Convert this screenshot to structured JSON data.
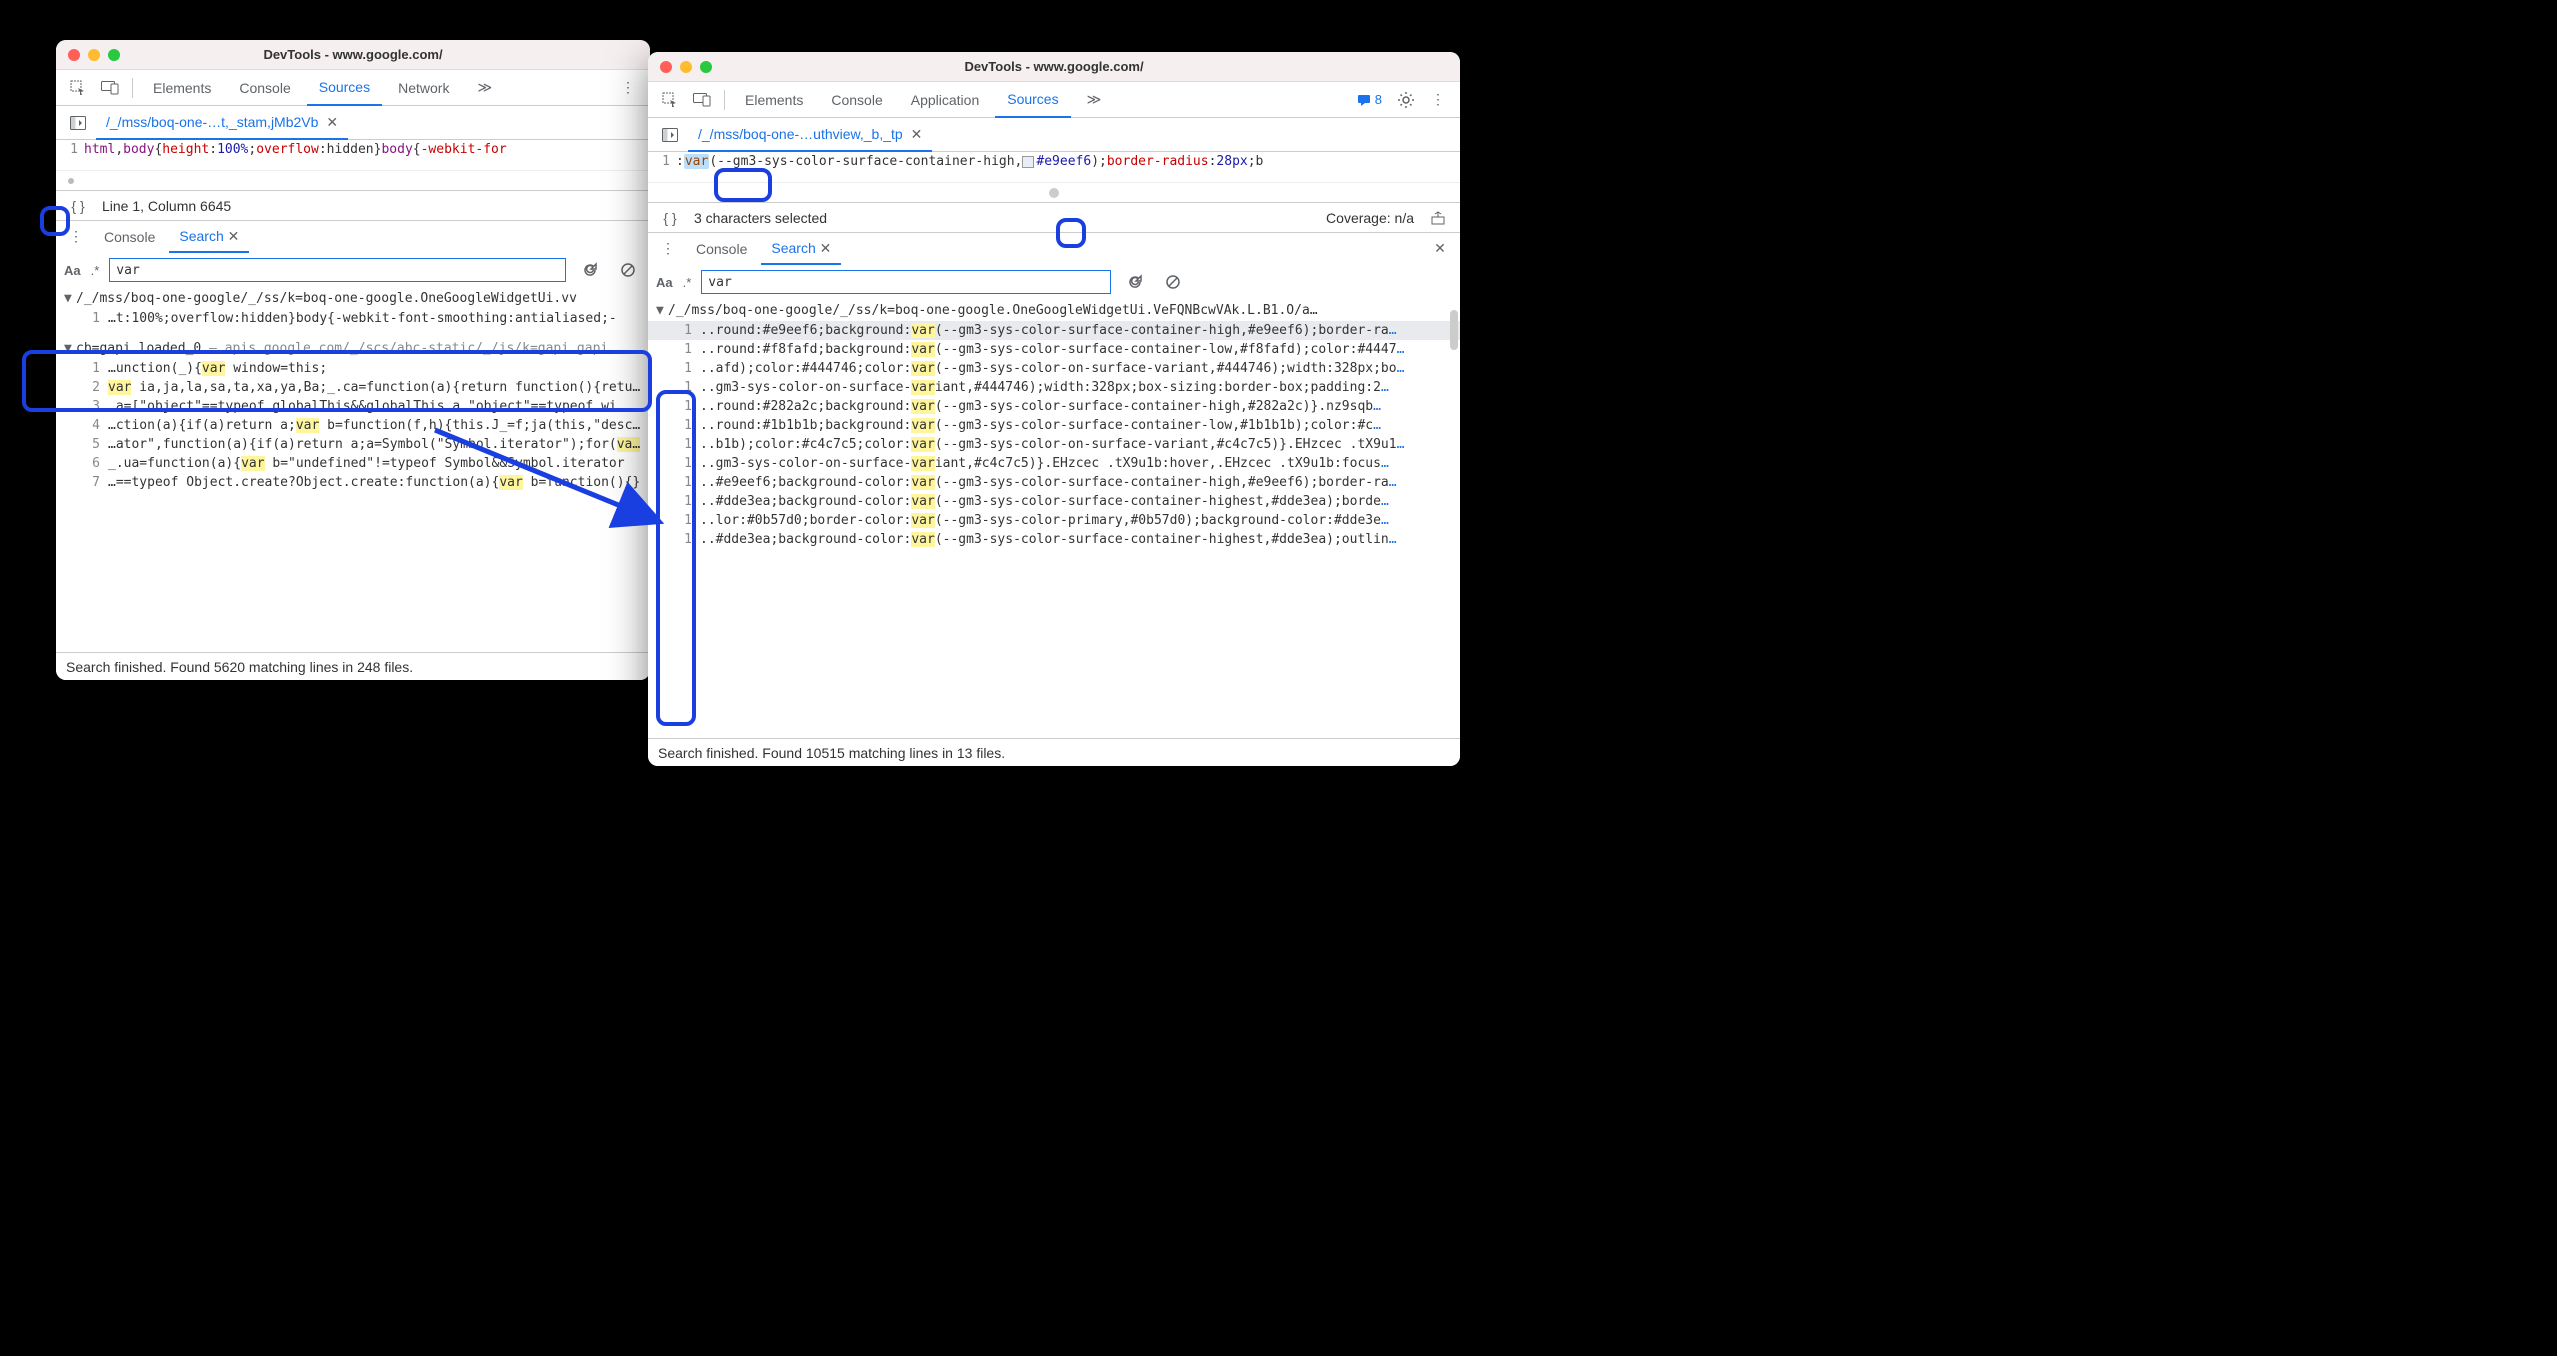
{
  "left": {
    "title": "DevTools - www.google.com/",
    "tabs": [
      "Elements",
      "Console",
      "Sources",
      "Network"
    ],
    "active_tab": "Sources",
    "overflow": "≫",
    "file_tab": "/_/mss/boq-one-…t,_stam,jMb2Vb",
    "code_line_num": "1",
    "code_html": "<span class='tok-tag'>html</span>,<span class='tok-tag'>body</span>{<span class='tok-prop'>height</span>:<span class='tok-num'>100%</span>;<span class='tok-prop'>overflow</span>:hidden}<span class='tok-tag'>body</span>{<span class='tok-prop'>-webkit-for</span>",
    "status": "Line 1, Column 6645",
    "drawer_tabs": [
      "Console",
      "Search"
    ],
    "drawer_active": "Search",
    "search_value": "var",
    "aa": "Aa",
    "regex": ".*",
    "file1": {
      "header": "/_/mss/boq-one-google/_/ss/k=boq-one-google.OneGoogleWidgetUi.vv",
      "rows": [
        {
          "ln": "1",
          "pre": "…t:100%;overflow:hidden}body{-webkit-font-smoothing:antialiased;-",
          "hl": "",
          "post": ""
        }
      ]
    },
    "file2": {
      "header": "cb=gapi.loaded_0",
      "sub": " — apis.google.com/_/scs/abc-static/_/js/k=gapi.gapi",
      "rows": [
        {
          "ln": "1",
          "pre": "…unction(_){",
          "hl": "var",
          "post": " window=this;"
        },
        {
          "ln": "2",
          "pre": "",
          "hl": "var",
          "post": " ia,ja,la,sa,ta,xa,ya,Ba;_.ca=function(a){return function(){return _.ba"
        },
        {
          "ln": "3",
          "pre": "…a=[\"object\"==typeof globalThis&&globalThis,a,\"object\"==typeof wi",
          "hl": "",
          "post": ""
        },
        {
          "ln": "4",
          "pre": "…ction(a){if(a)return a;",
          "hl": "var",
          "post": " b=function(f,h){this.J_=f;ja(this,\"description\""
        },
        {
          "ln": "5",
          "pre": "…ator\",function(a){if(a)return a;a=Symbol(\"Symbol.iterator\");for(",
          "hl": "var",
          "post": " b="
        },
        {
          "ln": "6",
          "pre": "_.ua=function(a){",
          "hl": "var",
          "post": " b=\"undefined\"!=typeof Symbol&&Symbol.iterator"
        },
        {
          "ln": "7",
          "pre": "…==typeof Object.create?Object.create:function(a){",
          "hl": "var",
          "post": " b=function(){}"
        }
      ]
    },
    "footer": "Search finished.  Found 5620 matching lines in 248 files."
  },
  "right": {
    "title": "DevTools - www.google.com/",
    "tabs": [
      "Elements",
      "Console",
      "Application",
      "Sources"
    ],
    "active_tab": "Sources",
    "overflow": "≫",
    "msg_count": "8",
    "file_tab": "/_/mss/boq-one-…uthview,_b,_tp",
    "code_line_num": "1",
    "code_pre": ":",
    "code_sel": "var",
    "code_post_html": "(--gm3-sys-color-surface-container-high,<span class='color-swatch' style='background:#e9eef6'></span><span class='tok-num'>#e9eef6</span>);<span class='tok-prop'>border-radius</span>:<span class='tok-num'>28px</span>;b",
    "status_left": "3 characters selected",
    "status_right": "Coverage: n/a",
    "drawer_tabs": [
      "Console",
      "Search"
    ],
    "drawer_active": "Search",
    "search_value": "var",
    "aa": "Aa",
    "regex": ".*",
    "file1": {
      "header": "/_/mss/boq-one-google/_/ss/k=boq-one-google.OneGoogleWidgetUi.VeFQNBcwVAk.L.B1.O/a…",
      "rows": [
        {
          "ln": "1",
          "pre": "..round:#e9eef6;background:",
          "hl": "var",
          "post": "(--gm3-sys-color-surface-container-high,#e9eef6);border-ra",
          "ell": "…",
          "sel": true
        },
        {
          "ln": "1",
          "pre": "..round:#f8fafd;background:",
          "hl": "var",
          "post": "(--gm3-sys-color-surface-container-low,#f8fafd);color:#4447",
          "ell": "…"
        },
        {
          "ln": "1",
          "pre": "..afd);color:#444746;color:",
          "hl": "var",
          "post": "(--gm3-sys-color-on-surface-variant,#444746);width:328px;bo",
          "ell": "…"
        },
        {
          "ln": "1",
          "pre": "..gm3-sys-color-on-surface-",
          "hl": "var",
          "post": "iant,#444746);width:328px;box-sizing:border-box;padding:2",
          "ell": "…"
        },
        {
          "ln": "1",
          "pre": "..round:#282a2c;background:",
          "hl": "var",
          "post": "(--gm3-sys-color-surface-container-high,#282a2c)}.nz9sqb",
          "ell": "…"
        },
        {
          "ln": "1",
          "pre": "..round:#1b1b1b;background:",
          "hl": "var",
          "post": "(--gm3-sys-color-surface-container-low,#1b1b1b);color:#c",
          "ell": "…"
        },
        {
          "ln": "1",
          "pre": "..b1b);color:#c4c7c5;color:",
          "hl": "var",
          "post": "(--gm3-sys-color-on-surface-variant,#c4c7c5)}.EHzcec .tX9u1",
          "ell": "…"
        },
        {
          "ln": "1",
          "pre": "..gm3-sys-color-on-surface-",
          "hl": "var",
          "post": "iant,#c4c7c5)}.EHzcec .tX9u1b:hover,.EHzcec .tX9u1b:focus",
          "ell": "…"
        },
        {
          "ln": "1",
          "pre": "..#e9eef6;background-color:",
          "hl": "var",
          "post": "(--gm3-sys-color-surface-container-high,#e9eef6);border-ra",
          "ell": "…"
        },
        {
          "ln": "1",
          "pre": "..#dde3ea;background-color:",
          "hl": "var",
          "post": "(--gm3-sys-color-surface-container-highest,#dde3ea);borde",
          "ell": "…"
        },
        {
          "ln": "1",
          "pre": "..lor:#0b57d0;border-color:",
          "hl": "var",
          "post": "(--gm3-sys-color-primary,#0b57d0);background-color:#dde3e",
          "ell": "…"
        },
        {
          "ln": "1",
          "pre": "..#dde3ea;background-color:",
          "hl": "var",
          "post": "(--gm3-sys-color-surface-container-highest,#dde3ea);outlin",
          "ell": "…"
        }
      ]
    },
    "footer": "Search finished.  Found 10515 matching lines in 13 files."
  }
}
